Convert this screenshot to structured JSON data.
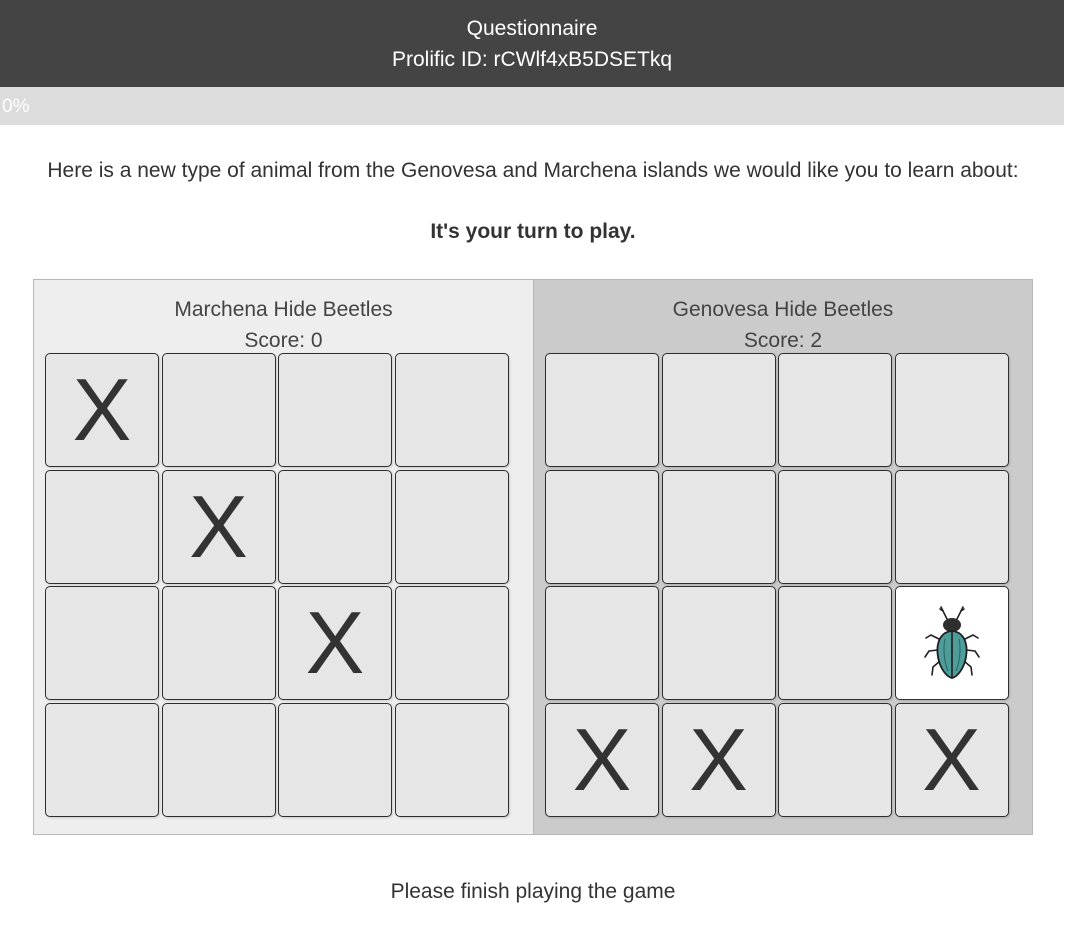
{
  "header": {
    "title": "Questionnaire",
    "subtitle": "Prolific ID: rCWlf4xB5DSETkq"
  },
  "progress": {
    "value_percent": 0,
    "label": "0%"
  },
  "intro_text": "Here is a new type of animal from the Genovesa and Marchena islands we would like you to learn about:",
  "turn_text": "It's your turn to play.",
  "boards": [
    {
      "name": "Marchena Hide Beetles",
      "score_label": "Score: 0",
      "cells": [
        [
          "X",
          "",
          "",
          ""
        ],
        [
          "",
          "X",
          "",
          ""
        ],
        [
          "",
          "",
          "X",
          ""
        ],
        [
          "",
          "",
          "",
          ""
        ]
      ]
    },
    {
      "name": "Genovesa Hide Beetles",
      "score_label": "Score: 2",
      "cells": [
        [
          "",
          "",
          "",
          ""
        ],
        [
          "",
          "",
          "",
          ""
        ],
        [
          "",
          "",
          "",
          "beetle-icon"
        ],
        [
          "X",
          "X",
          "",
          "X"
        ]
      ]
    }
  ],
  "footer_text": "Please finish playing the game",
  "colors": {
    "header_bg": "#444444",
    "progress_bg": "#dcdcdc",
    "left_panel_bg": "#eeeeee",
    "right_panel_bg": "#cbcbcb",
    "cell_bg": "#e6e6e6",
    "beetle_body": "#4e9d9b"
  }
}
